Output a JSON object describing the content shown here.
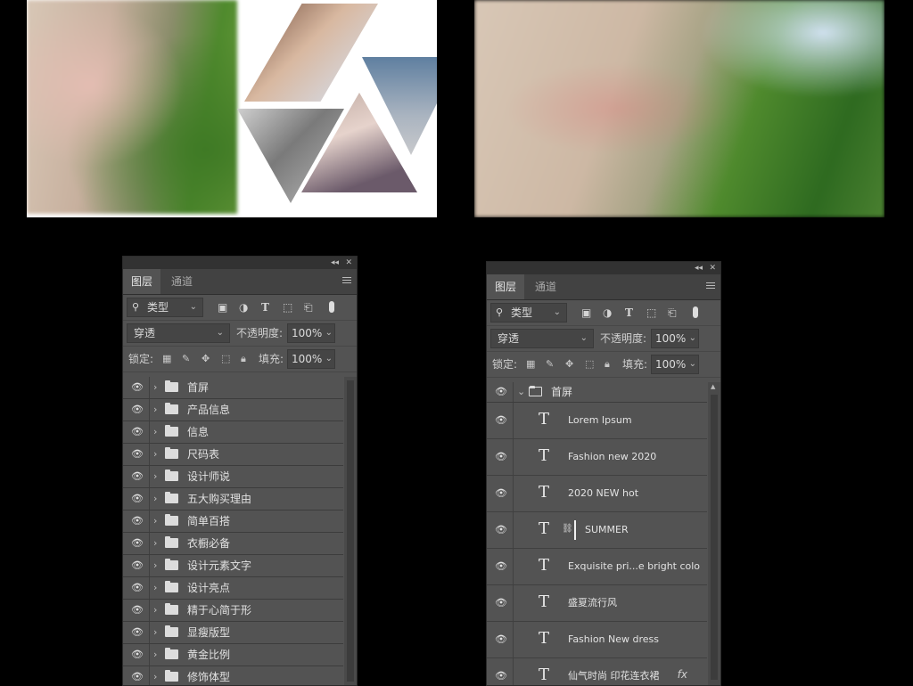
{
  "panels": {
    "left": {
      "tabs": [
        "图层",
        "通道"
      ],
      "filter_label": "类型",
      "blend_mode": "穿透",
      "opacity_label": "不透明度:",
      "opacity_value": "100%",
      "lock_label": "锁定:",
      "fill_label": "填充:",
      "fill_value": "100%",
      "layers": [
        "首屏",
        "产品信息",
        "信息",
        "尺码表",
        "设计师说",
        "五大购买理由",
        "简单百搭",
        "衣橱必备",
        "设计元素文字",
        "设计亮点",
        "精于心简于形",
        "显瘦版型",
        "黄金比例",
        "修饰体型"
      ]
    },
    "right": {
      "tabs": [
        "图层",
        "通道"
      ],
      "filter_label": "类型",
      "blend_mode": "穿透",
      "opacity_label": "不透明度:",
      "opacity_value": "100%",
      "lock_label": "锁定:",
      "fill_label": "填充:",
      "fill_value": "100%",
      "group_name": "首屏",
      "text_layers": [
        "Lorem Ipsum",
        "Fashion new 2020",
        "2020 NEW hot",
        "SUMMER",
        "Exquisite pri...e bright colo",
        "盛夏流行风",
        "Fashion New dress",
        "仙气时尚 印花连衣裙"
      ],
      "fx_label": "fx"
    }
  },
  "icons": {
    "eye": "eye-icon",
    "folder": "folder-icon",
    "text": "text-layer-icon"
  }
}
